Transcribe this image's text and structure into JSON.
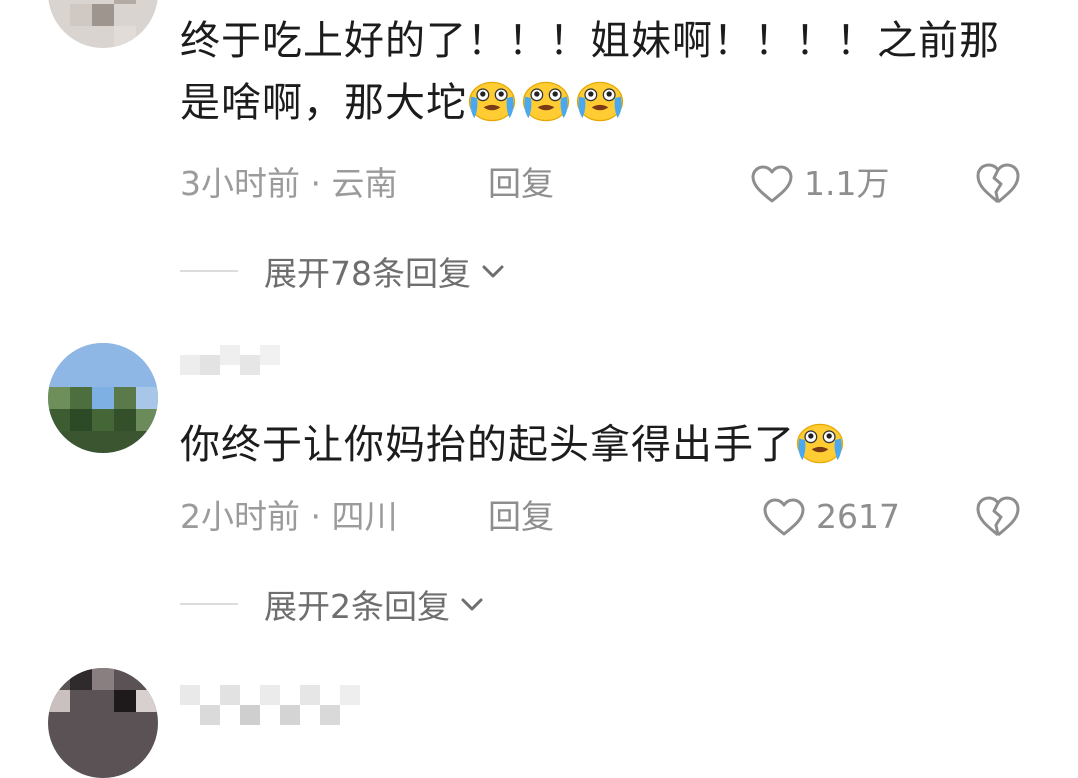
{
  "comments": [
    {
      "text": "终于吃上好的了！！！姐妹啊！！！！之前那是啥啊，那大坨",
      "emoji": "crying-emoji",
      "emoji_count": 3,
      "meta": "3小时前 · 云南",
      "reply_label": "回复",
      "likes": "1.1万",
      "expand_label": "展开78条回复"
    },
    {
      "text": "你终于让你妈抬的起头拿得出手了",
      "emoji": "crying-emoji",
      "emoji_count": 1,
      "meta": "2小时前 · 四川",
      "reply_label": "回复",
      "likes": "2617",
      "expand_label": "展开2条回复"
    }
  ],
  "colors": {
    "text": "#1c1c1c",
    "meta": "#9b9b9b",
    "icon": "#8e8e8e",
    "emoji_face": "#ffcc33",
    "emoji_tear": "#4aa8f0"
  }
}
